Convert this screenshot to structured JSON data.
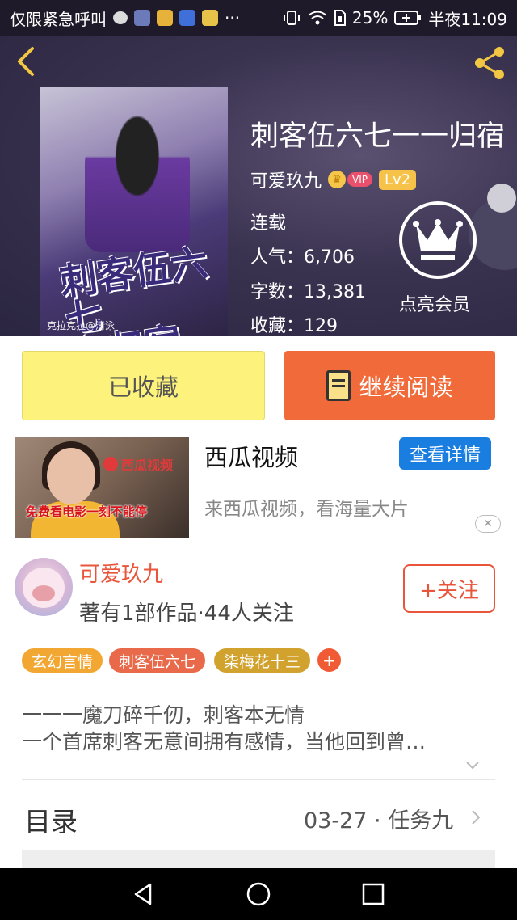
{
  "status_bar": {
    "notice": "仅限紧急呼叫",
    "more": "···",
    "battery": "25%",
    "time": "半夜11:09"
  },
  "book": {
    "title": "刺客伍六七一一归宿",
    "author": "可爱玖九",
    "vip_label": "VIP",
    "level_label": "Lv2",
    "status": "连载",
    "popularity": "人气：6,706",
    "word_count": "字数：13,381",
    "favorites": "收藏：129",
    "member_label": "点亮会员",
    "cover": {
      "title_line1": "刺客伍六七",
      "title_line2": "之归宿",
      "credit": "克拉克拉@清泳"
    }
  },
  "actions": {
    "collected_label": "已收藏",
    "continue_label": "继续阅读"
  },
  "ad": {
    "title": "西瓜视频",
    "detail_label": "查看详情",
    "desc": "来西瓜视频，看海量大片",
    "thumb_brand": "西瓜视频",
    "thumb_slogan": "免费看电影一刻不能停",
    "close_label": "✕"
  },
  "author_card": {
    "name": "可爱玖九",
    "stats": "著有1部作品·44人关注",
    "follow_label": "+关注"
  },
  "tags": [
    {
      "label": "玄幻言情",
      "color": "#f2a732"
    },
    {
      "label": "刺客伍六七",
      "color": "#e86a4a"
    },
    {
      "label": "柒梅花十三",
      "color": "#d2a22e"
    }
  ],
  "tag_add_label": "+",
  "synopsis": {
    "line1": "一一一魔刀碎千仞，刺客本无情",
    "line2": "一个首席刺客无意间拥有感情，当他回到曾…"
  },
  "toc": {
    "label": "目录",
    "latest": "03-27 · 任务九"
  },
  "colors": {
    "accent_orange": "#f06b39",
    "collected_yellow": "#fdf27c",
    "link_blue": "#1a7ee0",
    "author_red": "#e8553a"
  }
}
